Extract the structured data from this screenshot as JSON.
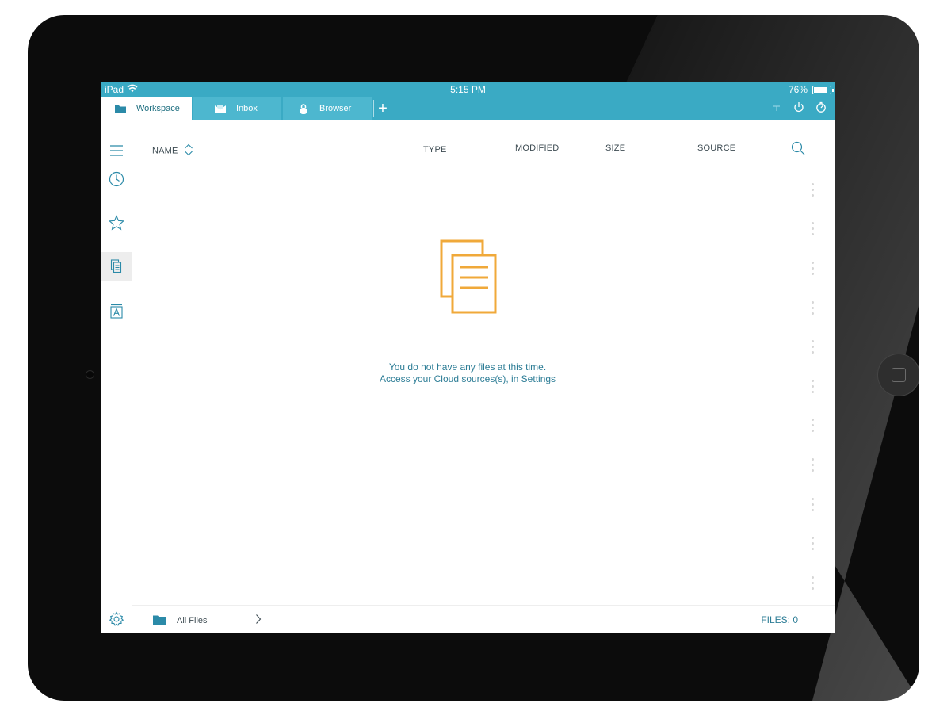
{
  "status_bar": {
    "device": "iPad",
    "time": "5:15 PM",
    "battery": "76%"
  },
  "tabs": [
    {
      "label": "Workspace",
      "icon": "folder-icon",
      "active": true
    },
    {
      "label": "Inbox",
      "icon": "inbox-icon",
      "active": false
    },
    {
      "label": "Browser",
      "icon": "lock-icon",
      "active": false
    }
  ],
  "tab_actions": [
    "add-tab-icon",
    "pin-icon",
    "power-icon",
    "timer-icon"
  ],
  "sidebar": [
    "menu-icon",
    "recent-clock-icon",
    "favorites-star-icon",
    "documents-icon",
    "fonts-icon",
    "settings-gear-icon"
  ],
  "columns": {
    "name": "NAME",
    "type": "TYPE",
    "modified": "MODIFIED",
    "size": "SIZE",
    "source": "SOURCE"
  },
  "empty_state": {
    "icon": "documents-stack-icon",
    "line1": "You do not have any files at this time.",
    "line2": "Access your Cloud sources(s), in Settings"
  },
  "footer": {
    "location": "All Files",
    "files_count": "FILES: 0"
  },
  "colors": {
    "accent": "#3aaac4",
    "tab_inactive": "#4db7cf",
    "empty_icon": "#f0a93a",
    "text_teal": "#2d7d96"
  }
}
